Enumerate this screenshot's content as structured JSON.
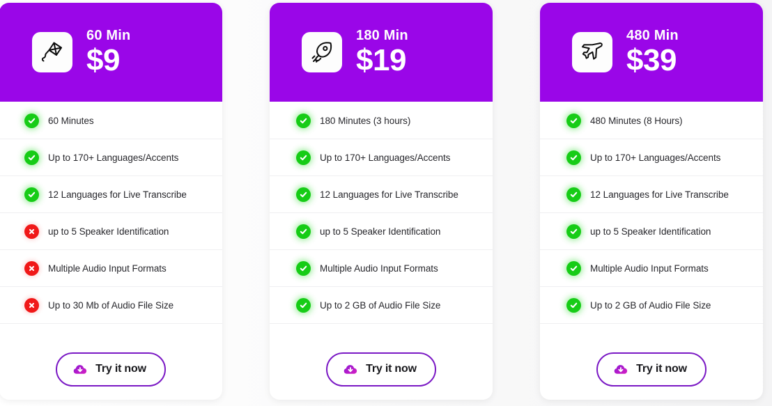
{
  "theme": {
    "header_purple": "#9a06e8",
    "check_green": "#16cc16",
    "cross_red": "#f01818",
    "button_border": "#7a18c4",
    "page_background": "#f3f3f4"
  },
  "plans": [
    {
      "icon": "kite-icon",
      "duration": "60 Min",
      "price": "$9",
      "features": [
        {
          "label": "60 Minutes",
          "status": "included"
        },
        {
          "label": "Up to 170+ Languages/Accents",
          "status": "included"
        },
        {
          "label": "12 Languages for Live Transcribe",
          "status": "included"
        },
        {
          "label": "up to 5 Speaker Identification",
          "status": "excluded"
        },
        {
          "label": "Multiple Audio Input Formats",
          "status": "excluded"
        },
        {
          "label": "Up to 30 Mb of Audio File Size",
          "status": "excluded"
        }
      ],
      "cta": "Try it now"
    },
    {
      "icon": "rocket-icon",
      "duration": "180 Min",
      "price": "$19",
      "features": [
        {
          "label": "180 Minutes (3 hours)",
          "status": "included"
        },
        {
          "label": "Up to 170+ Languages/Accents",
          "status": "included"
        },
        {
          "label": "12 Languages for Live Transcribe",
          "status": "included"
        },
        {
          "label": "up to 5 Speaker Identification",
          "status": "included"
        },
        {
          "label": "Multiple Audio Input Formats",
          "status": "included"
        },
        {
          "label": "Up to 2 GB of Audio File Size",
          "status": "included"
        }
      ],
      "cta": "Try it now"
    },
    {
      "icon": "airplane-icon",
      "duration": "480 Min",
      "price": "$39",
      "features": [
        {
          "label": "480 Minutes (8 Hours)",
          "status": "included"
        },
        {
          "label": "Up to 170+ Languages/Accents",
          "status": "included"
        },
        {
          "label": "12 Languages for Live Transcribe",
          "status": "included"
        },
        {
          "label": "up to 5 Speaker Identification",
          "status": "included"
        },
        {
          "label": "Multiple Audio Input Formats",
          "status": "included"
        },
        {
          "label": "Up to 2 GB of Audio File Size",
          "status": "included"
        }
      ],
      "cta": "Try it now"
    }
  ]
}
